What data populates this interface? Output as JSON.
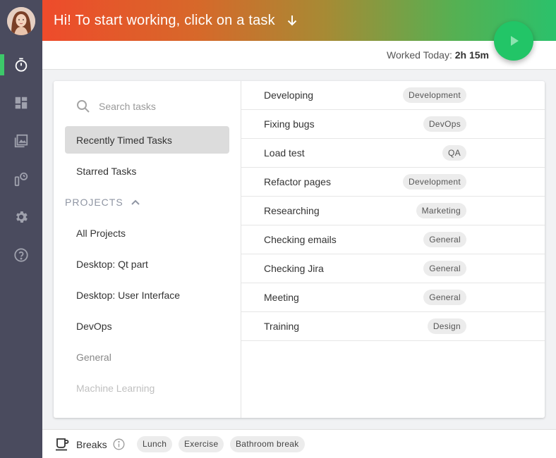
{
  "header": {
    "title": "Hi! To start working, click on a task",
    "arrow_icon": "arrow-down-icon",
    "worked_label": "Worked Today:",
    "worked_value": "2h 15m"
  },
  "sidebar": {
    "items": [
      {
        "name": "timer",
        "icon": "stopwatch-icon",
        "active": true
      },
      {
        "name": "dashboard",
        "icon": "dashboard-icon"
      },
      {
        "name": "screenshots",
        "icon": "image-gallery-icon"
      },
      {
        "name": "timesheet",
        "icon": "time-tracking-icon"
      },
      {
        "name": "settings",
        "icon": "gear-icon"
      },
      {
        "name": "help",
        "icon": "question-icon"
      }
    ]
  },
  "search": {
    "placeholder": "Search tasks"
  },
  "nav": {
    "recent": "Recently Timed Tasks",
    "starred": "Starred Tasks",
    "projects_heading": "PROJECTS"
  },
  "projects": [
    "All Projects",
    "Desktop: Qt part",
    "Desktop: User Interface",
    "DevOps",
    "General",
    "Machine Learning"
  ],
  "tasks": [
    {
      "name": "Developing",
      "tag": "Development"
    },
    {
      "name": "Fixing bugs",
      "tag": "DevOps"
    },
    {
      "name": "Load test",
      "tag": "QA"
    },
    {
      "name": "Refactor pages",
      "tag": "Development"
    },
    {
      "name": "Researching",
      "tag": "Marketing"
    },
    {
      "name": "Checking emails",
      "tag": "General"
    },
    {
      "name": "Checking Jira",
      "tag": "General"
    },
    {
      "name": "Meeting",
      "tag": "General"
    },
    {
      "name": "Training",
      "tag": "Design"
    }
  ],
  "breaks": {
    "label": "Breaks",
    "items": [
      "Lunch",
      "Exercise",
      "Bathroom break"
    ]
  },
  "colors": {
    "accent_green": "#22c567",
    "sidebar_bg": "#4a4b5e",
    "header_start": "#ee4b2b",
    "header_end": "#2bc16b"
  }
}
